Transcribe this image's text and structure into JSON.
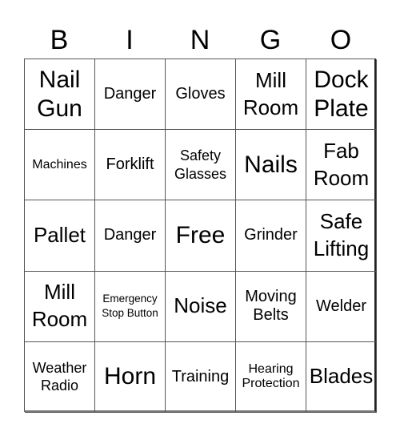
{
  "header": [
    "B",
    "I",
    "N",
    "G",
    "O"
  ],
  "cells": [
    {
      "text": "Nail Gun",
      "size": "s-xl"
    },
    {
      "text": "Danger",
      "size": "s-m"
    },
    {
      "text": "Gloves",
      "size": "s-m"
    },
    {
      "text": "Mill Room",
      "size": "s-l"
    },
    {
      "text": "Dock Plate",
      "size": "s-xl"
    },
    {
      "text": "Machines",
      "size": "s-xs"
    },
    {
      "text": "Forklift",
      "size": "s-m"
    },
    {
      "text": "Safety Glasses",
      "size": "s-s"
    },
    {
      "text": "Nails",
      "size": "s-xl"
    },
    {
      "text": "Fab Room",
      "size": "s-l"
    },
    {
      "text": "Pallet",
      "size": "s-l"
    },
    {
      "text": "Danger",
      "size": "s-m"
    },
    {
      "text": "Free",
      "size": "s-xl"
    },
    {
      "text": "Grinder",
      "size": "s-m"
    },
    {
      "text": "Safe Lifting",
      "size": "s-l"
    },
    {
      "text": "Mill Room",
      "size": "s-l"
    },
    {
      "text": "Emergency Stop Button",
      "size": "s-xxs"
    },
    {
      "text": "Noise",
      "size": "s-l"
    },
    {
      "text": "Moving Belts",
      "size": "s-m"
    },
    {
      "text": "Welder",
      "size": "s-m"
    },
    {
      "text": "Weather Radio",
      "size": "s-s"
    },
    {
      "text": "Horn",
      "size": "s-xl"
    },
    {
      "text": "Training",
      "size": "s-m"
    },
    {
      "text": "Hearing Protection",
      "size": "s-xs"
    },
    {
      "text": "Blades",
      "size": "s-l"
    }
  ]
}
